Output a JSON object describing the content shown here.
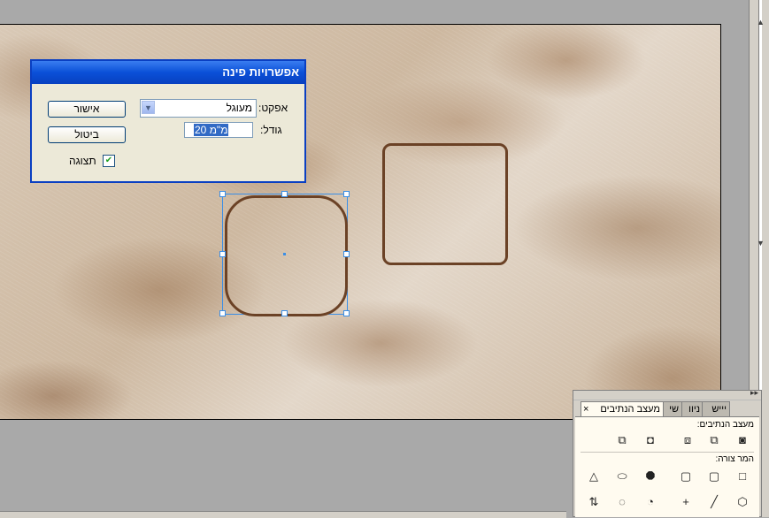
{
  "dialog": {
    "title": "אפשרויות פינה",
    "ok_label": "אישור",
    "cancel_label": "ביטול",
    "effect_label": "אפקט:",
    "effect_value": "מעוגל",
    "size_label": "גודל:",
    "size_value": "20 מ\"מ",
    "preview_label": "תצוגה",
    "preview_checked": true
  },
  "panel": {
    "tabs": [
      "מעצב הנתיבים",
      "ניוו",
      "שי",
      "יייש"
    ],
    "pathfinder_label": "מעצב הנתיבים:",
    "shape_mode_label": "המר צורה:",
    "pathfinder_icons": [
      "add-icon",
      "subtract-icon",
      "intersect-icon",
      "exclude-icon",
      "minus-back-icon"
    ],
    "shape_icons_row1": [
      "rectangle-icon",
      "rounded-rectangle-icon",
      "beveled-rectangle-icon",
      "inverse-rounded-rectangle-icon",
      "ellipse-icon",
      "triangle-icon"
    ],
    "shape_icons_row2": [
      "polygon-icon",
      "line-icon",
      "orthogonal-line-icon",
      "open-path-icon",
      "close-path-icon",
      "reverse-path-icon"
    ]
  },
  "colors": {
    "stroke": "#6b4226",
    "selection": "#3a8ee6",
    "titlebar": "#0a50d8"
  }
}
